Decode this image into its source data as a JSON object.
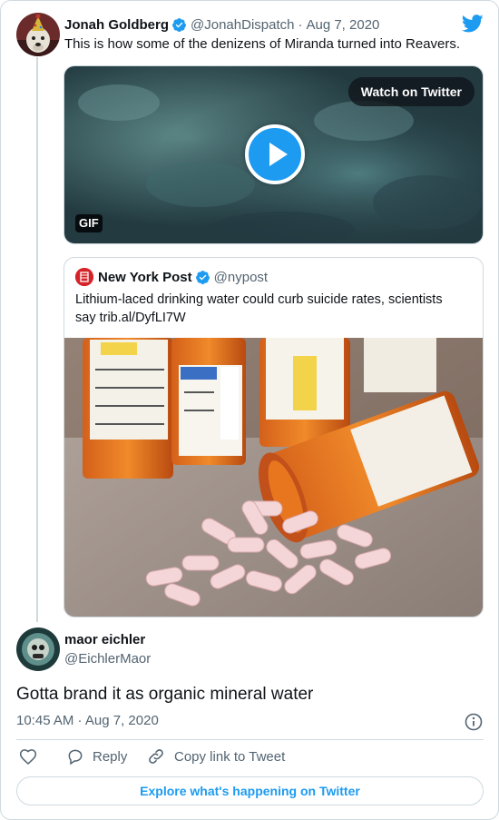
{
  "parent_tweet": {
    "author_name": "Jonah Goldberg",
    "author_handle": "@JonahDispatch",
    "separator": "·",
    "date": "Aug 7, 2020",
    "text": "This is how some of the denizens of Miranda turned into Reavers.",
    "media": {
      "watch_label": "Watch on Twitter",
      "badge": "GIF"
    },
    "quoted": {
      "author_name": "New York Post",
      "author_handle": "@nypost",
      "text_line1": "Lithium-laced drinking water could curb suicide rates, scientists",
      "text_line2": "say trib.al/DyfLI7W"
    }
  },
  "reply": {
    "author_name": "maor eichler",
    "author_handle": "@EichlerMaor",
    "text": "Gotta brand it as organic mineral water",
    "timestamp": "10:45 AM · Aug 7, 2020"
  },
  "actions": {
    "reply_label": "Reply",
    "copy_link_label": "Copy link to Tweet",
    "explore_label": "Explore what's happening on Twitter"
  },
  "colors": {
    "twitter_blue": "#1d9bf0",
    "text": "#0f1419",
    "muted": "#536471",
    "border": "#cfd9de",
    "nypost_red": "#d6232a"
  },
  "icons": [
    "twitter-logo-icon",
    "verified-badge-icon",
    "play-icon",
    "nypost-logo-icon",
    "info-icon",
    "heart-icon",
    "reply-icon",
    "link-icon"
  ]
}
